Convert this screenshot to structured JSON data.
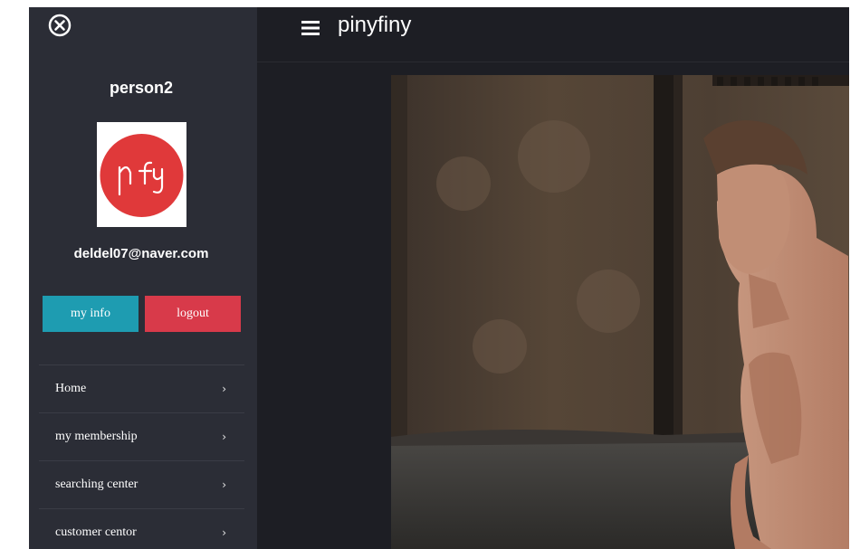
{
  "sidebar": {
    "username": "person2",
    "avatar_logo_text": "pfy",
    "email": "deldel07@naver.com",
    "buttons": {
      "my_info": "my info",
      "logout": "logout"
    },
    "menu": [
      {
        "label": "Home",
        "icon": "chevron-right-icon"
      },
      {
        "label": "my membership",
        "icon": "chevron-right-icon"
      },
      {
        "label": "searching center",
        "icon": "chevron-right-icon"
      },
      {
        "label": "customer centor",
        "icon": "chevron-right-icon"
      }
    ],
    "close_icon": "close-circle-icon"
  },
  "header": {
    "title": "pinyfiny",
    "menu_icon": "hamburger-icon"
  },
  "colors": {
    "sidebar_bg": "#2b2d36",
    "header_bg": "#1d1e24",
    "info_button": "#1e9cb1",
    "logout_button": "#d83a4a",
    "logo_red": "#e0393a"
  },
  "hero": {
    "image": "fitness-man-in-gym-photo"
  }
}
